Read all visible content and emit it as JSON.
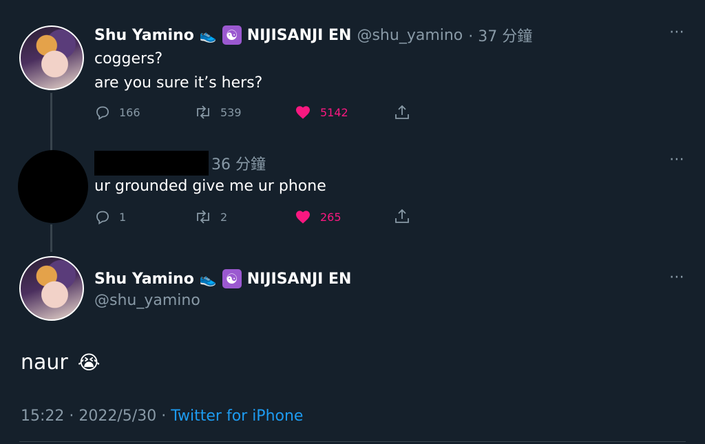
{
  "tweet1": {
    "name": "Shu Yamino",
    "org": "NIJISANJI EN",
    "handle": "@shu_yamino",
    "time": "· 37 分鐘",
    "lines": [
      "coggers?",
      "are you sure it’s hers?"
    ],
    "replies": "166",
    "retweets": "539",
    "likes": "5142"
  },
  "tweet2": {
    "time": "36 分鐘",
    "text": "ur grounded give me ur phone",
    "replies": "1",
    "retweets": "2",
    "likes": "265"
  },
  "main": {
    "name": "Shu Yamino",
    "org": "NIJISANJI EN",
    "handle": "@shu_yamino",
    "text": "naur",
    "emoji": "😭",
    "time": "15:22",
    "date": "2022/5/30",
    "client": "Twitter for iPhone"
  },
  "icons": {
    "reply": "reply-icon",
    "retweet": "retweet-icon",
    "like": "heart-icon",
    "share": "share-icon",
    "more": "more-icon",
    "shoe": "shoe-icon",
    "yin_yang": "yin-yang-icon"
  },
  "colors": {
    "background": "#15202b",
    "muted": "#8899a6",
    "like": "#f91880",
    "link": "#1d9bf0"
  }
}
